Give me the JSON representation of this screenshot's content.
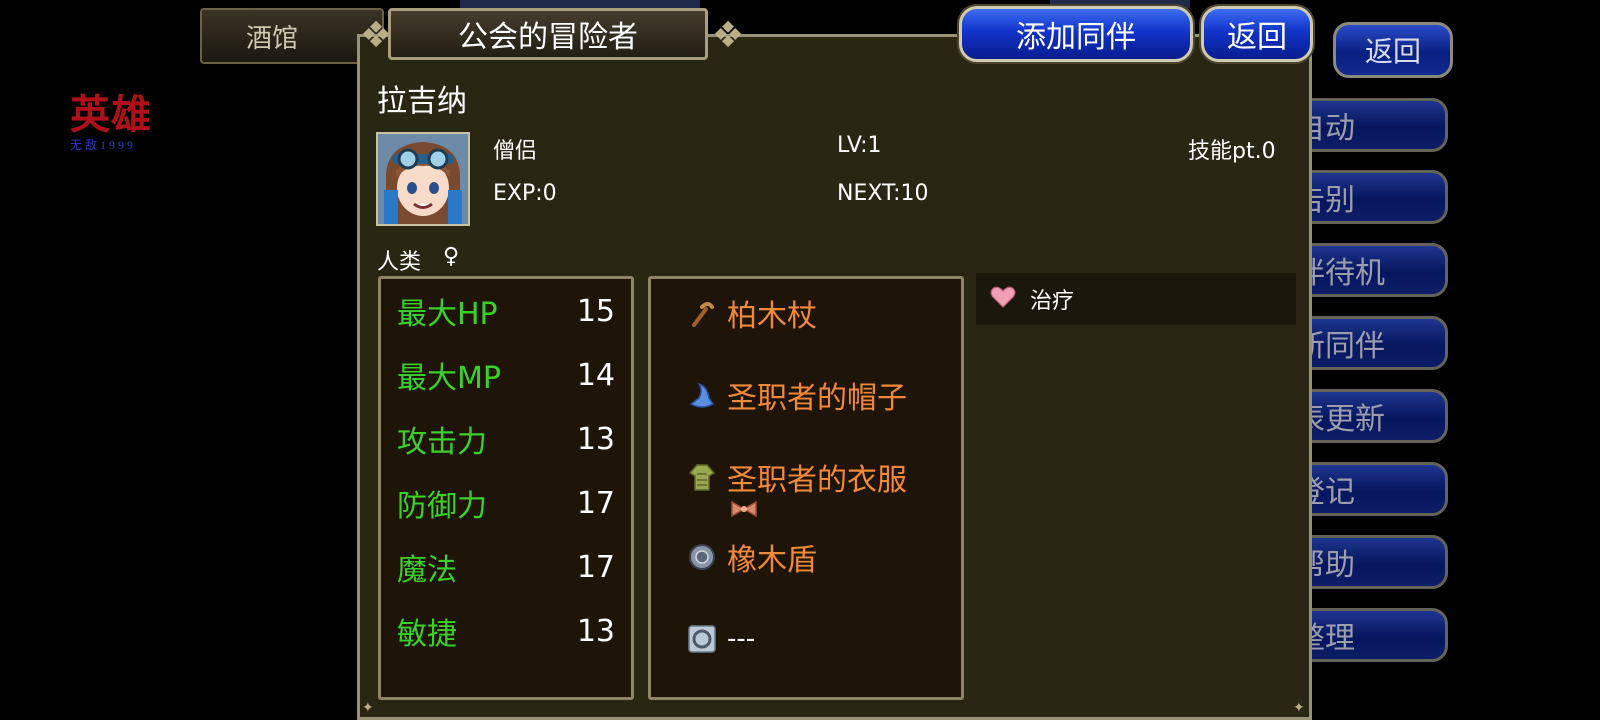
{
  "logo": {
    "main": "英雄",
    "sub": "无敌1999"
  },
  "background": {
    "tab_tavern": "酒馆",
    "back_label": "返回",
    "menu_partial": [
      "自动",
      "告别",
      "伴待机",
      "新同伴",
      "表更新",
      "登记",
      "帮助",
      "整理"
    ]
  },
  "dialog": {
    "title": "公会的冒险者",
    "add_companion_label": "添加同伴",
    "back_label": "返回"
  },
  "character": {
    "name": "拉吉纳",
    "class": "僧侣",
    "level": "LV:1",
    "skill_pt": "技能pt.0",
    "exp": "EXP:0",
    "next": "NEXT:10",
    "race": "人类",
    "sex": "♀"
  },
  "stats": [
    {
      "name": "最大HP",
      "value": "15"
    },
    {
      "name": "最大MP",
      "value": "14"
    },
    {
      "name": "攻击力",
      "value": "13"
    },
    {
      "name": "防御力",
      "value": "17"
    },
    {
      "name": "魔法",
      "value": "17"
    },
    {
      "name": "敏捷",
      "value": "13"
    }
  ],
  "equipment": [
    {
      "icon": "staff-icon",
      "name": "柏木杖"
    },
    {
      "icon": "hat-icon",
      "name": "圣职者的帽子"
    },
    {
      "icon": "robe-icon",
      "name": "圣职者的衣服"
    },
    {
      "icon": "shield-icon",
      "name": "橡木盾"
    },
    {
      "icon": "ring-icon",
      "name": "---"
    }
  ],
  "skills": [
    {
      "icon": "heart-icon",
      "name": "治疗"
    }
  ],
  "colors": {
    "stat_name": "#3ad12a",
    "equip_name": "#f0893a",
    "button_blue": "#1133c9",
    "panel_bg": "#1f1408",
    "dialog_bg": "#2a2614"
  }
}
